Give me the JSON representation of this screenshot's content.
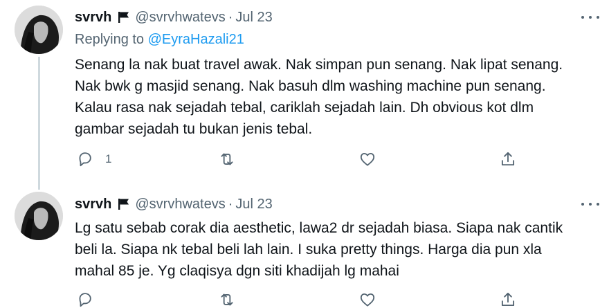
{
  "tweets": [
    {
      "name": "svrvh",
      "handle": "@svrvhwatevs",
      "separator": "·",
      "date": "Jul 23",
      "replying_prefix": "Replying to ",
      "replying_to": "@EyraHazali21",
      "lines": [
        "Senang la nak buat travel awak. Nak simpan pun senang. Nak lipat senang.",
        "Nak bwk g masjid senang. Nak basuh dlm washing machine pun senang.",
        "Kalau rasa nak sejadah tebal, cariklah sejadah lain. Dh obvious kot dlm",
        "gambar sejadah tu bukan jenis tebal."
      ],
      "reply_count": "1"
    },
    {
      "name": "svrvh",
      "handle": "@svrvhwatevs",
      "separator": "·",
      "date": "Jul 23",
      "lines": [
        "Lg satu sebab corak dia aesthetic, lawa2 dr sejadah biasa. Siapa nak cantik",
        "beli la. Siapa nk tebal beli lah lain. I suka pretty things. Harga dia pun xla",
        "mahal 85 je. Yg claqisya dgn siti khadijah lg mahai"
      ]
    }
  ],
  "icons": {
    "verified_flag": "flag-icon",
    "more": "more-options-icon",
    "reply": "reply-icon",
    "retweet": "retweet-icon",
    "like": "like-icon",
    "share": "share-icon"
  },
  "colors": {
    "text": "#0f1419",
    "secondary": "#536471",
    "link": "#1d9bf0",
    "thread_line": "#cfd9de"
  }
}
